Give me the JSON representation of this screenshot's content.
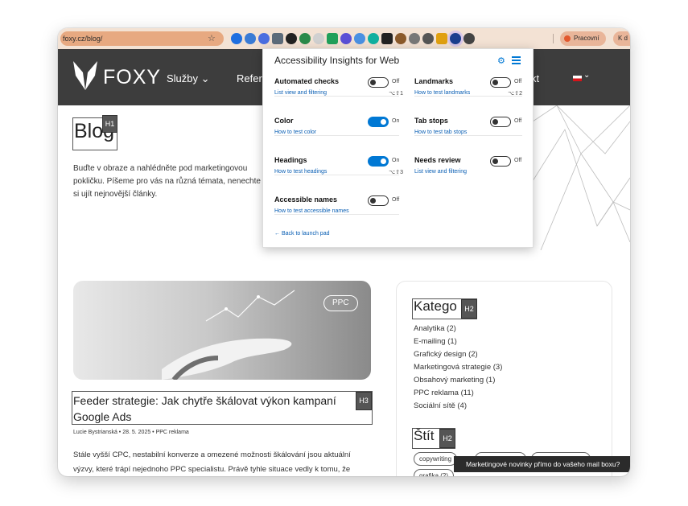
{
  "browser": {
    "url": "foxy.cz/blog/",
    "star_icon": "☆",
    "profile_label": "Pracovní",
    "profile2_label": "K d",
    "extension_colors": [
      "#1f6fe0",
      "#3a7bd5",
      "#4a6ee0",
      "#5c6b7a",
      "#222222",
      "#2a8a4a",
      "#d0d0d0",
      "#21a05a",
      "#5a4fd6",
      "#4a90e2",
      "#10b0a0",
      "#222222",
      "#8b5a2b",
      "#777777",
      "#555555",
      "#e0a010",
      "#1b3f8f",
      "#444444"
    ]
  },
  "header": {
    "brand": "FOXY",
    "nav_sluzby": "Služby ⌄",
    "nav_reference": "Refere",
    "nav_kontakt": "kt",
    "lang_chevron": "⌄"
  },
  "hero": {
    "title": "Blog",
    "title_tag": "H1",
    "intro": "Buďte v obraze a nahlédněte pod marketingovou pokličku. Píšeme pro vás na různá témata, nenechte si ujít nejnovější články."
  },
  "article": {
    "badge": "PPC",
    "title": "Feeder strategie: Jak chytře škálovat výkon kampaní Google Ads",
    "title_tag": "H3",
    "meta": "Lucie Bystrianská • 28. 5. 2025 • PPC reklama",
    "excerpt": "Stále vyšší CPC, nestabilní konverze a omezené možnosti škálování jsou aktuální výzvy, které trápí nejednoho PPC specialistu. Právě tyhle situace vedly k tomu, že"
  },
  "sidebar": {
    "categories_title": "Katego",
    "categories_tag": "H2",
    "categories": [
      "Analytika (2)",
      "E-mailing (1)",
      "Grafický design (2)",
      "Marketingová strategie (3)",
      "Obsahový marketing (1)",
      "PPC reklama (11)",
      "Sociální sítě (4)"
    ],
    "tags_title": "Štít",
    "tags_tag": "H2",
    "tags": [
      "copywriting",
      "grafika (2)"
    ],
    "toast": "Marketingové novinky přímo do vašeho mail boxu?"
  },
  "popup": {
    "title": "Accessibility Insights for Web",
    "gear_icon": "⚙",
    "items": [
      {
        "name": "Automated checks",
        "link": "List view and filtering",
        "state": "Off",
        "shortcut": "⌥⇧1"
      },
      {
        "name": "Landmarks",
        "link": "How to test landmarks",
        "state": "Off",
        "shortcut": "⌥⇧2"
      },
      {
        "name": "Color",
        "link": "How to test color",
        "state": "On",
        "shortcut": ""
      },
      {
        "name": "Tab stops",
        "link": "How to test tab stops",
        "state": "Off",
        "shortcut": ""
      },
      {
        "name": "Headings",
        "link": "How to test headings",
        "state": "On",
        "shortcut": "⌥⇧3"
      },
      {
        "name": "Needs review",
        "link": "List view and filtering",
        "state": "Off",
        "shortcut": ""
      },
      {
        "name": "Accessible names",
        "link": "How to test accessible names",
        "state": "Off",
        "shortcut": ""
      }
    ],
    "back_link": "← Back to launch pad"
  },
  "colors": {
    "header_bg": "#3d3d3d",
    "toolbar_bg": "#f3e2d4",
    "url_bg": "#e7a981",
    "accent_blue": "#0078d4",
    "link_blue": "#0a5fb4",
    "tag_bg": "#555555"
  }
}
